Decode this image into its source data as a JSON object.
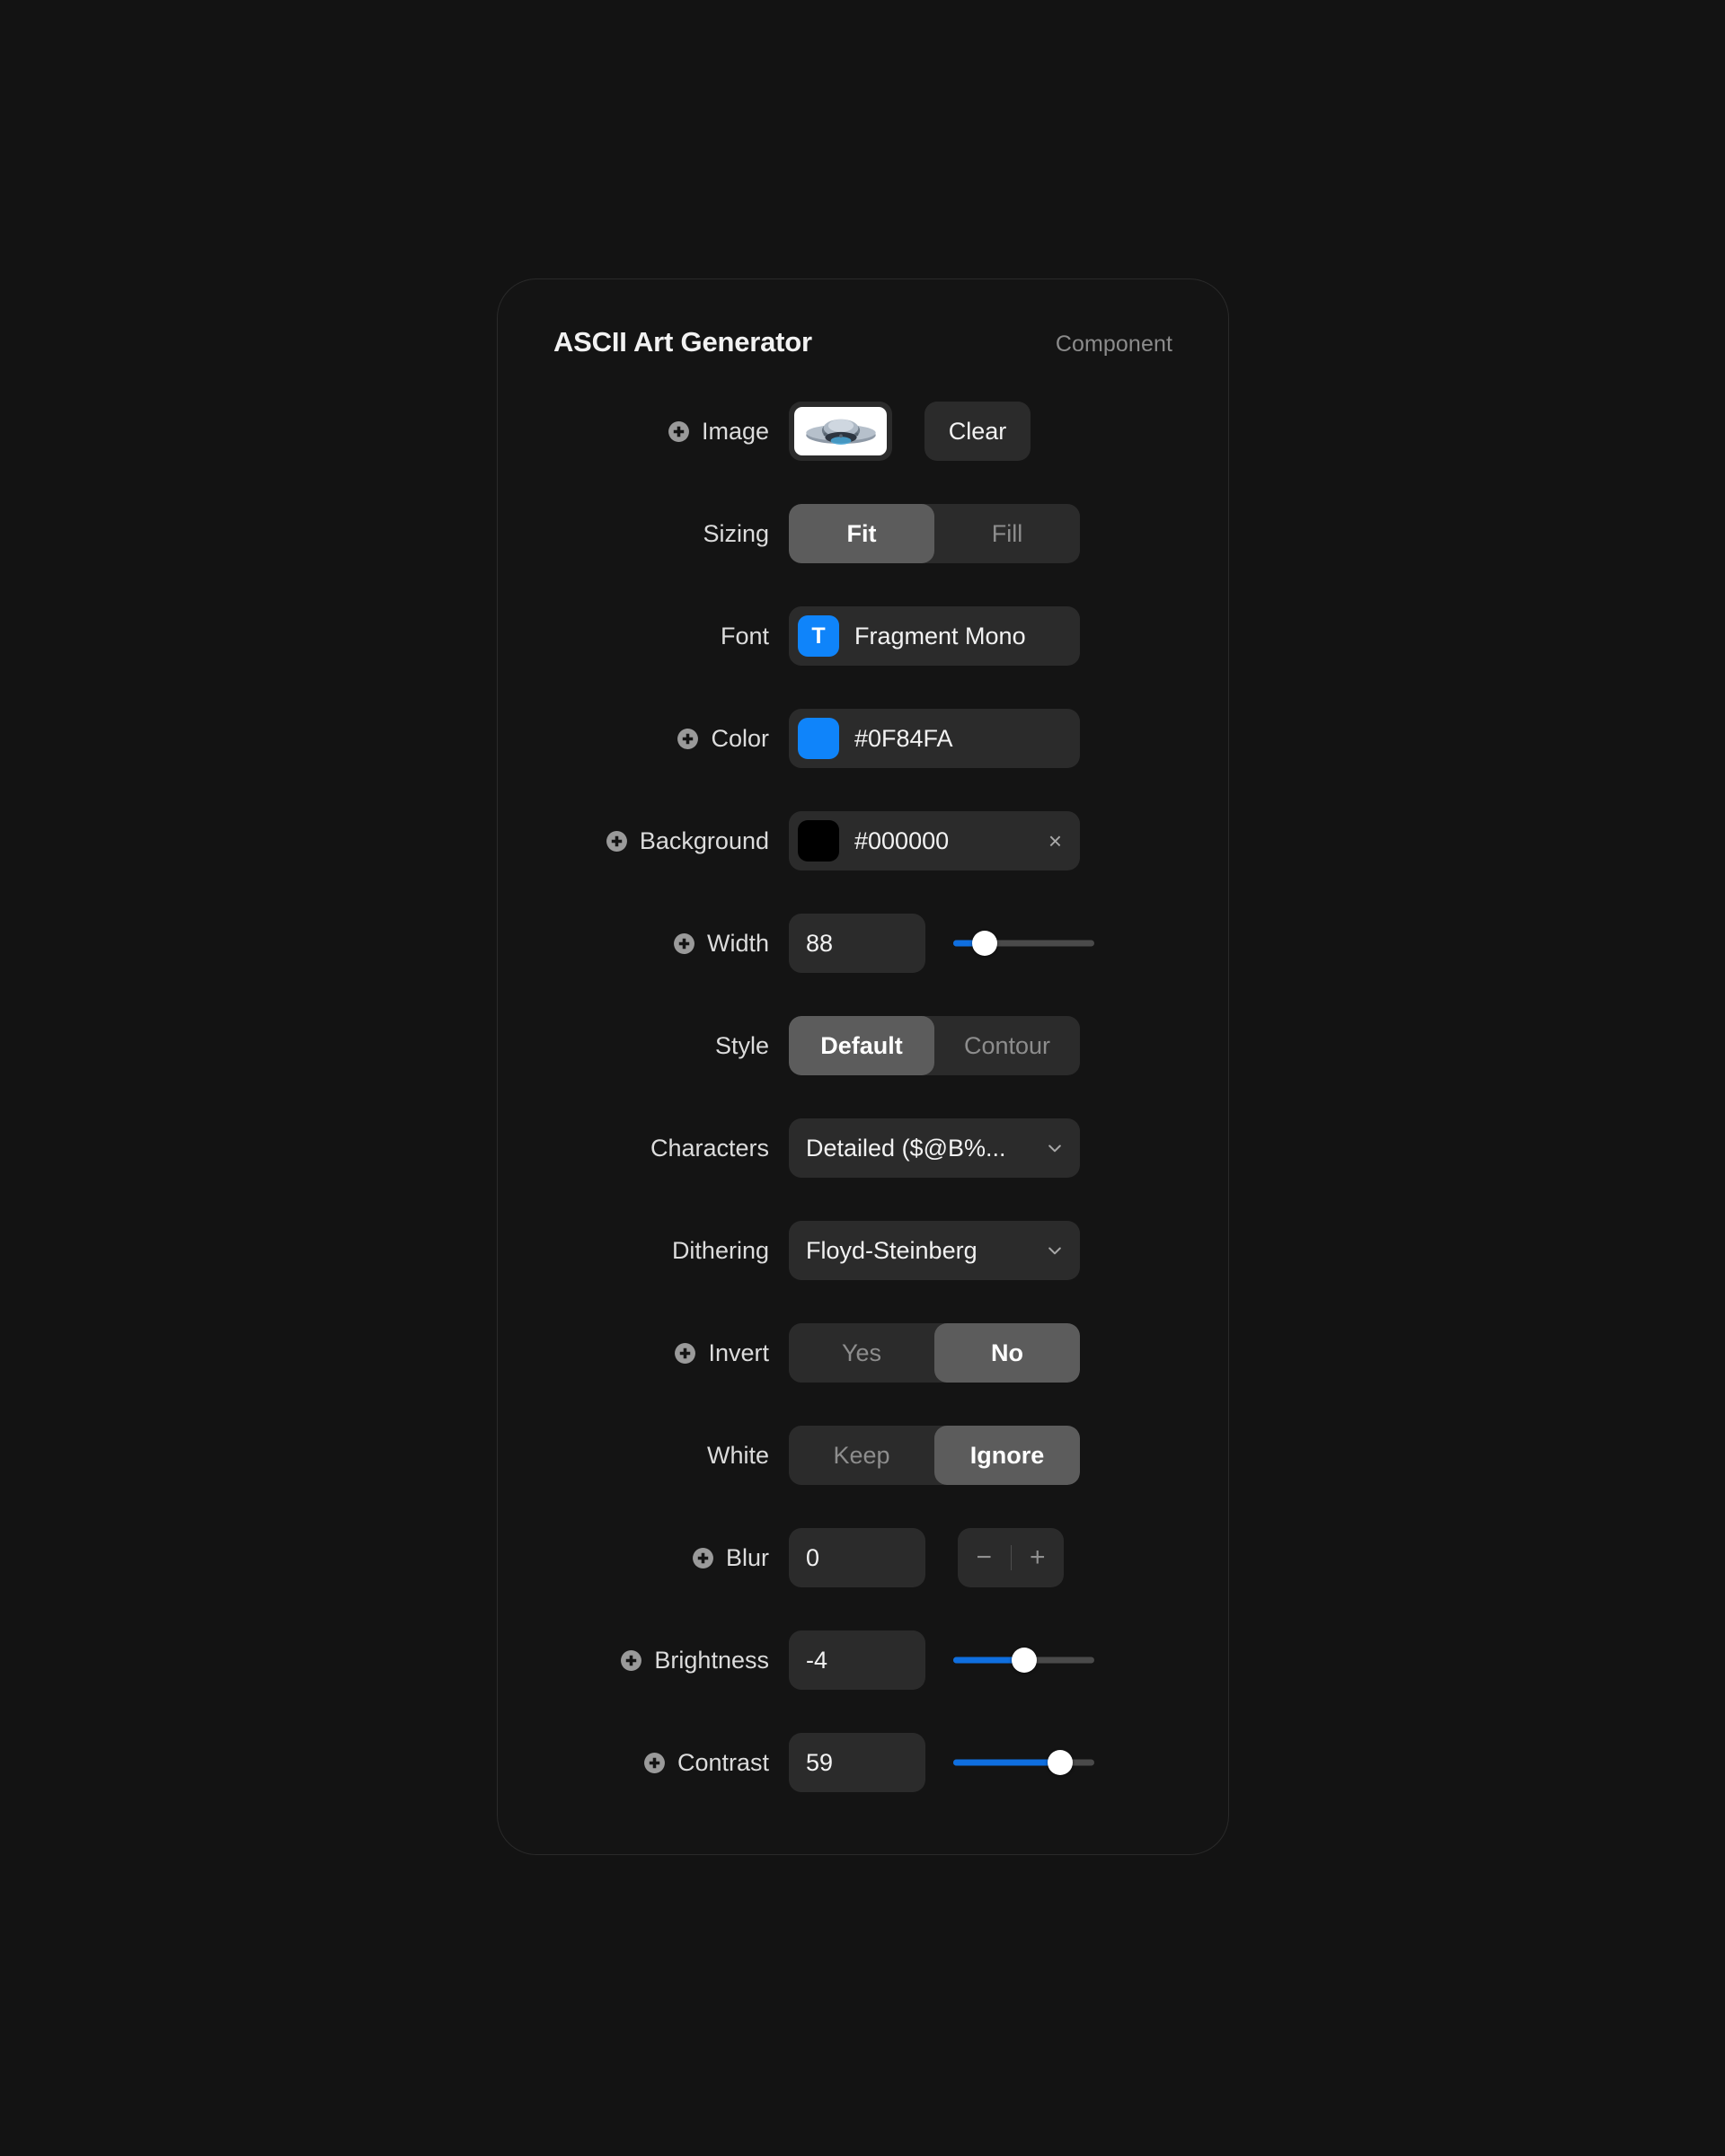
{
  "panel": {
    "title": "ASCII Art Generator",
    "kind": "Component"
  },
  "colors": {
    "accent_blue": "#0F84FA",
    "slider_fill": "#0F6FE0",
    "panel_bg": "#141414",
    "field_bg": "#2B2B2B",
    "segment_selected_bg": "#5C5C5C",
    "page_bg": "#131313"
  },
  "rows": {
    "image": {
      "label": "Image",
      "has_plus": true,
      "thumbnail_icon": "ufo-emoji",
      "clear_label": "Clear"
    },
    "sizing": {
      "label": "Sizing",
      "has_plus": false,
      "options": [
        "Fit",
        "Fill"
      ],
      "selected": "Fit"
    },
    "font": {
      "label": "Font",
      "has_plus": false,
      "swatch_glyph": "T",
      "swatch_color": "#0F84FA",
      "value": "Fragment Mono"
    },
    "color": {
      "label": "Color",
      "has_plus": true,
      "swatch_color": "#0F84FA",
      "value": "#0F84FA"
    },
    "background": {
      "label": "Background",
      "has_plus": true,
      "swatch_color": "#000000",
      "value": "#000000",
      "clear_glyph": "×"
    },
    "width": {
      "label": "Width",
      "has_plus": true,
      "value": "88",
      "slider_percent": 22
    },
    "style": {
      "label": "Style",
      "has_plus": false,
      "options": [
        "Default",
        "Contour"
      ],
      "selected": "Default"
    },
    "characters": {
      "label": "Characters",
      "has_plus": false,
      "value": "Detailed ($@B%..."
    },
    "dithering": {
      "label": "Dithering",
      "has_plus": false,
      "value": "Floyd-Steinberg"
    },
    "invert": {
      "label": "Invert",
      "has_plus": true,
      "options": [
        "Yes",
        "No"
      ],
      "selected": "No"
    },
    "white": {
      "label": "White",
      "has_plus": false,
      "options": [
        "Keep",
        "Ignore"
      ],
      "selected": "Ignore"
    },
    "blur": {
      "label": "Blur",
      "has_plus": true,
      "value": "0",
      "decrement_glyph": "−",
      "increment_glyph": "+"
    },
    "brightness": {
      "label": "Brightness",
      "has_plus": true,
      "value": "-4",
      "slider_percent": 50
    },
    "contrast": {
      "label": "Contrast",
      "has_plus": true,
      "value": "59",
      "slider_percent": 76
    }
  }
}
